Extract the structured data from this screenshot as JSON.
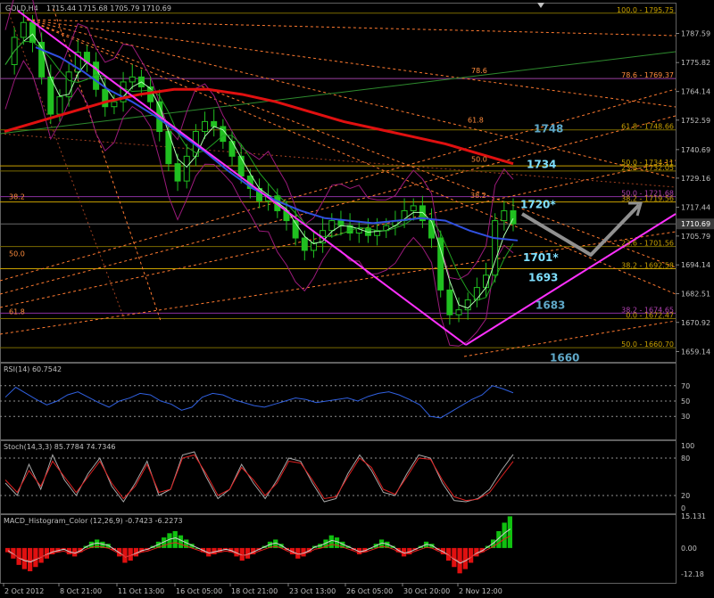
{
  "chart_data": [
    {
      "type": "candlestick",
      "title": "GOLD,H4",
      "ohlc_readout": "1715.44 1715.68 1705.79 1710.69",
      "last_price": "1710.69",
      "y_ticks": [
        "1787.59",
        "1775.82",
        "1764.14",
        "1752.59",
        "1740.69",
        "1729.16",
        "1717.44",
        "1705.79",
        "1694.14",
        "1682.51",
        "1670.92",
        "1659.14"
      ],
      "ylim": [
        1655,
        1800
      ],
      "x_ticks": [
        "2 Oct 2012",
        "8 Oct 21:00",
        "11 Oct 13:00",
        "16 Oct 05:00",
        "18 Oct 21:00",
        "23 Oct 13:00",
        "26 Oct 05:00",
        "30 Oct 20:00",
        "2 Nov 12:00"
      ],
      "close_path": [
        1775,
        1786,
        1792,
        1784,
        1770,
        1755,
        1762,
        1772,
        1780,
        1776,
        1765,
        1758,
        1760,
        1768,
        1770,
        1766,
        1760,
        1748,
        1735,
        1728,
        1738,
        1748,
        1752,
        1750,
        1744,
        1738,
        1730,
        1725,
        1720,
        1722,
        1716,
        1712,
        1705,
        1700,
        1703,
        1708,
        1712,
        1710,
        1707,
        1709,
        1706,
        1708,
        1710,
        1712,
        1716,
        1718,
        1712,
        1705,
        1684,
        1674,
        1676,
        1680,
        1685,
        1690,
        1712,
        1716,
        1710.69
      ],
      "fib_labels": [
        {
          "text": "100.0 - 1795.75",
          "price": 1795.75,
          "color": "#c8a000"
        },
        {
          "text": "78.6",
          "price": 1771.3,
          "color": "#ff8c3c"
        },
        {
          "text": "78.6 - 1769.37",
          "price": 1769.37,
          "color": "#ff8c3c"
        },
        {
          "text": "61.8",
          "price": 1751.2,
          "color": "#ff8c3c"
        },
        {
          "text": "61.8 - 1748.66",
          "price": 1748.66,
          "color": "#c8a000"
        },
        {
          "text": "50.0",
          "price": 1735.4,
          "color": "#ff8c3c"
        },
        {
          "text": "50.0 - 1734.11",
          "price": 1734.11,
          "color": "#c8a000"
        },
        {
          "text": "23.6 - 1732.05",
          "price": 1732.05,
          "color": "#c8a000"
        },
        {
          "text": "38.2",
          "price": 1720.9,
          "color": "#ff8c3c"
        },
        {
          "text": "50.0 - 1721.68",
          "price": 1721.68,
          "color": "#b040b0"
        },
        {
          "text": "38.2 - 1719.56",
          "price": 1719.56,
          "color": "#c8a000"
        },
        {
          "text": "23.6 - 1701.56",
          "price": 1701.56,
          "color": "#c8a000"
        },
        {
          "text": "38.2 - 1692.58",
          "price": 1692.58,
          "color": "#c8a000"
        },
        {
          "text": "38.2 - 1674.65",
          "price": 1674.65,
          "color": "#b040b0"
        },
        {
          "text": "0.0 - 1672.47",
          "price": 1672.47,
          "color": "#c8a000"
        },
        {
          "text": "50.0 - 1660.70",
          "price": 1660.7,
          "color": "#c8a000"
        },
        {
          "text": "38.2",
          "price": 1719.9,
          "color": "#ff8c3c",
          "side": "left"
        },
        {
          "text": "50.0",
          "price": 1697.0,
          "color": "#ff8c3c",
          "side": "left"
        },
        {
          "text": "61.8",
          "price": 1673.6,
          "color": "#ff8c3c",
          "side": "left"
        }
      ],
      "annotations": [
        {
          "text": "1748",
          "price": 1749.5,
          "color": "#5fa8c8",
          "size": 12
        },
        {
          "text": "1734",
          "price": 1735.0,
          "color": "#7fe0ff",
          "size": 12
        },
        {
          "text": "1720*",
          "price": 1718.8,
          "color": "#7fe0ff",
          "size": 12
        },
        {
          "text": "1701*",
          "price": 1697.5,
          "color": "#7fe0ff",
          "size": 12
        },
        {
          "text": "1693",
          "price": 1689.3,
          "color": "#7fe0ff",
          "size": 12
        },
        {
          "text": "1683",
          "price": 1678.2,
          "color": "#5fa8c8",
          "size": 12
        },
        {
          "text": "1660",
          "price": 1657.0,
          "color": "#5fa8c8",
          "size": 12
        }
      ],
      "colors": {
        "bull": "#20c020",
        "bear": "#20c020",
        "ma_red": "#e01010",
        "ma_blue": "#3050e0",
        "channel": "#ff30ff",
        "fib": "#ff8c3c",
        "projection": "#909090"
      }
    },
    {
      "type": "line",
      "title": "RSI(14) 60.7542",
      "y_ticks": [
        "70",
        "50",
        "30"
      ],
      "ylim": [
        0,
        100
      ],
      "series": [
        {
          "values": [
            55,
            68,
            60,
            52,
            45,
            50,
            58,
            62,
            55,
            48,
            42,
            50,
            54,
            60,
            58,
            50,
            46,
            38,
            42,
            55,
            60,
            58,
            52,
            48,
            44,
            42,
            46,
            50,
            54,
            52,
            48,
            50,
            52,
            54,
            50,
            56,
            60,
            62,
            58,
            52,
            45,
            30,
            28,
            36,
            44,
            52,
            58,
            70,
            66,
            60.75
          ]
        }
      ],
      "color": "#3060e0"
    },
    {
      "type": "line",
      "title": "Stoch(14,3,3) 85.7784 74.7346",
      "y_ticks": [
        "100",
        "80",
        "20",
        "0"
      ],
      "ylim": [
        0,
        100
      ],
      "series": [
        {
          "values": [
            40,
            20,
            70,
            30,
            85,
            45,
            20,
            55,
            80,
            35,
            10,
            40,
            75,
            20,
            30,
            85,
            90,
            50,
            15,
            30,
            70,
            40,
            15,
            45,
            80,
            75,
            40,
            10,
            15,
            55,
            85,
            60,
            25,
            20,
            55,
            85,
            80,
            40,
            12,
            10,
            15,
            30,
            60,
            85.78
          ]
        },
        {
          "values": [
            45,
            25,
            60,
            35,
            75,
            50,
            25,
            50,
            75,
            40,
            15,
            35,
            70,
            25,
            30,
            80,
            85,
            55,
            20,
            30,
            65,
            45,
            20,
            40,
            75,
            72,
            45,
            15,
            18,
            50,
            80,
            65,
            30,
            22,
            50,
            80,
            78,
            45,
            18,
            12,
            14,
            25,
            50,
            74.73
          ]
        }
      ],
      "colors": [
        "#a8a8a8",
        "#e02020"
      ]
    },
    {
      "type": "bar",
      "title": "MACD_Histogram_Color (12,26,9) -0.7423 -6.2273",
      "y_ticks": [
        "15.131",
        "0.00",
        "-12.18"
      ],
      "ylim": [
        -16.5,
        16
      ],
      "values": [
        -2,
        -5,
        -8,
        -10,
        -11,
        -9,
        -7,
        -5,
        -3,
        -2,
        -1,
        -3,
        -4,
        -2,
        1,
        3,
        4,
        3,
        2,
        -1,
        -4,
        -7,
        -6,
        -4,
        -2,
        -1,
        1,
        3,
        5,
        7,
        8,
        6,
        4,
        2,
        0,
        -2,
        -4,
        -3,
        -2,
        -1,
        -2,
        -4,
        -6,
        -5,
        -3,
        -1,
        1,
        3,
        4,
        2,
        -1,
        -3,
        -5,
        -4,
        -2,
        1,
        2,
        4,
        6,
        5,
        3,
        1,
        -1,
        -3,
        -2,
        0,
        2,
        4,
        3,
        1,
        -2,
        -4,
        -3,
        -1,
        1,
        3,
        2,
        -1,
        -3,
        -6,
        -9,
        -12,
        -10,
        -7,
        -4,
        -2,
        1,
        4,
        8,
        12,
        15
      ],
      "colors": {
        "pos": "#10c010",
        "neg": "#e01010"
      }
    }
  ]
}
